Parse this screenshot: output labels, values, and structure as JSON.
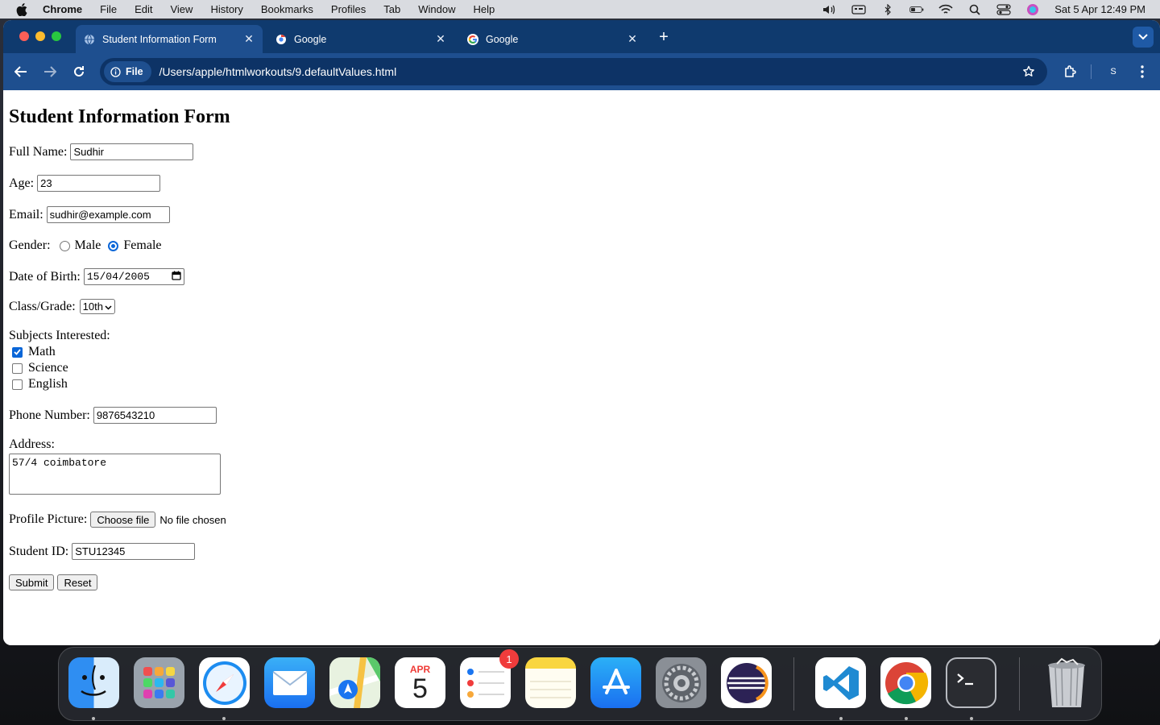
{
  "menubar": {
    "items": [
      "Chrome",
      "File",
      "Edit",
      "View",
      "History",
      "Bookmarks",
      "Profiles",
      "Tab",
      "Window",
      "Help"
    ],
    "clock": "Sat 5 Apr  12:49 PM"
  },
  "browser": {
    "tabs": [
      {
        "label": "Student Information Form",
        "icon": "globe-icon",
        "active": true
      },
      {
        "label": "Google",
        "icon": "chrome-loading-icon",
        "active": false
      },
      {
        "label": "Google",
        "icon": "google-g-icon",
        "active": false
      }
    ],
    "chip_label": "File",
    "url": "/Users/apple/htmlworkouts/9.defaultValues.html",
    "profile_initial": "S"
  },
  "form": {
    "heading": "Student Information Form",
    "full_name_label": "Full Name:",
    "full_name_value": "Sudhir",
    "age_label": "Age:",
    "age_value": "23",
    "email_label": "Email:",
    "email_value": "sudhir@example.com",
    "gender_label": "Gender:",
    "gender_male": "Male",
    "gender_female": "Female",
    "gender_selected": "Female",
    "dob_label": "Date of Birth:",
    "dob_value": "15/04/2005",
    "class_label": "Class/Grade:",
    "class_value": "10th",
    "subjects_label": "Subjects Interested:",
    "subjects": [
      {
        "label": "Math",
        "checked": true
      },
      {
        "label": "Science",
        "checked": false
      },
      {
        "label": "English",
        "checked": false
      }
    ],
    "phone_label": "Phone Number:",
    "phone_value": "9876543210",
    "address_label": "Address:",
    "address_value": "57/4 coimbatore",
    "picture_label": "Profile Picture:",
    "choose_file": "Choose file",
    "no_file": "No file chosen",
    "student_id_label": "Student ID:",
    "student_id_value": "STU12345",
    "submit": "Submit",
    "reset": "Reset"
  },
  "dock": {
    "calendar_month": "APR",
    "calendar_day": "5",
    "reminders_badge": "1",
    "apps": [
      "finder-icon",
      "launchpad-icon",
      "safari-icon",
      "mail-icon",
      "maps-icon",
      "calendar-icon",
      "reminders-icon",
      "notes-icon",
      "app-store-icon",
      "system-settings-icon",
      "eclipse-icon",
      "vscode-icon",
      "chrome-icon",
      "terminal-icon",
      "trash-icon"
    ]
  },
  "colors": {
    "tabstrip": "#0f3a6e",
    "toolbar": "#1e4f8f",
    "radio_accent": "#0a66d8"
  }
}
